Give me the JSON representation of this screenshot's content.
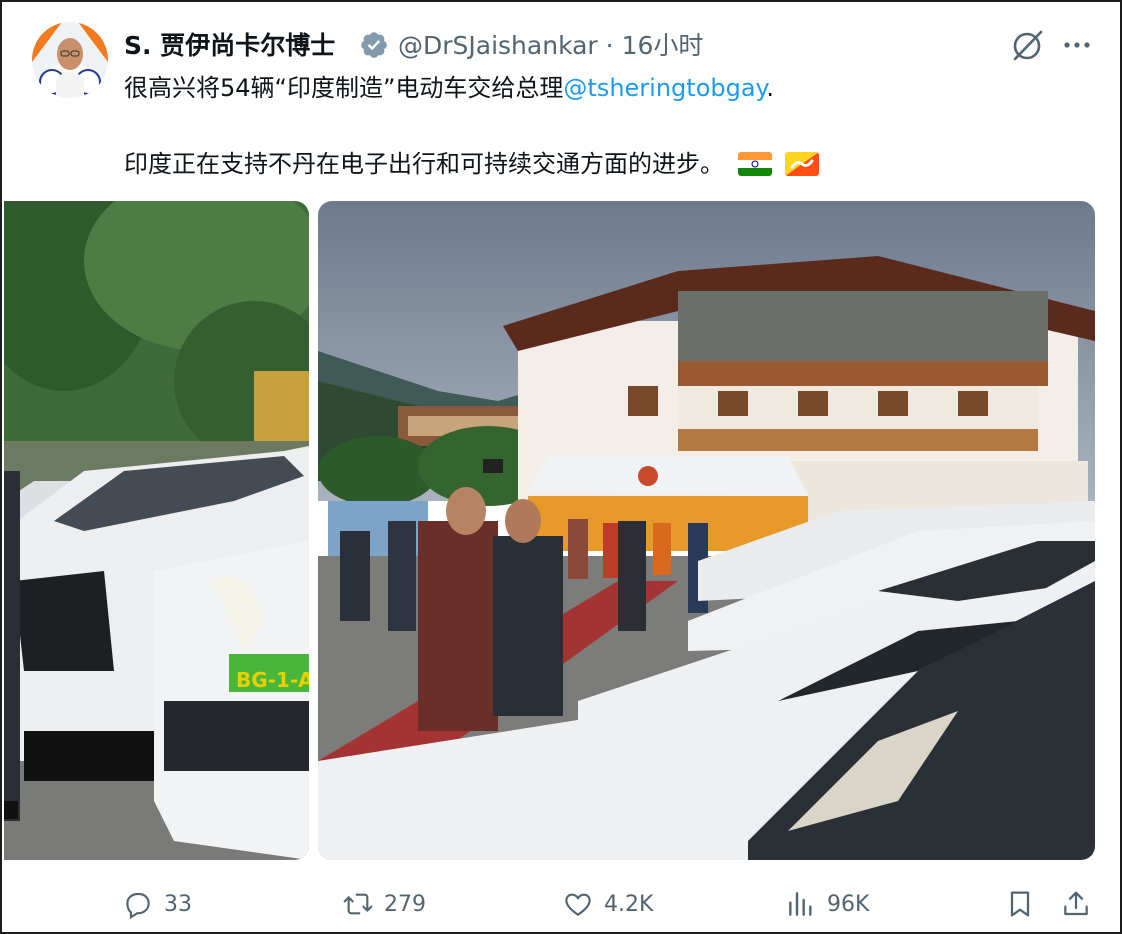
{
  "tweet": {
    "author_name": "S. 贾伊尚卡尔博士",
    "handle": "@DrSJaishankar",
    "separator": "·",
    "time": "16小时",
    "text_line1_prefix": "很高兴将54辆“印度制造”电动车交给总理",
    "mention": "@tsheringtobgay",
    "text_line1_suffix": ".",
    "text_line2": "印度正在支持不丹在电子出行和可持续交通方面的进步。",
    "flags": [
      "india-flag",
      "bhutan-flag"
    ],
    "plate_text": "BG-1-A"
  },
  "header_icons": [
    "verified-badge-icon",
    "grok-icon",
    "more-icon"
  ],
  "actions": {
    "reply_count": "33",
    "retweet_count": "279",
    "like_count": "4.2K",
    "views_count": "96K"
  },
  "colors": {
    "text": "#0f1419",
    "secondary": "#536471",
    "link": "#1d9bf0",
    "verified": "#829aab"
  }
}
